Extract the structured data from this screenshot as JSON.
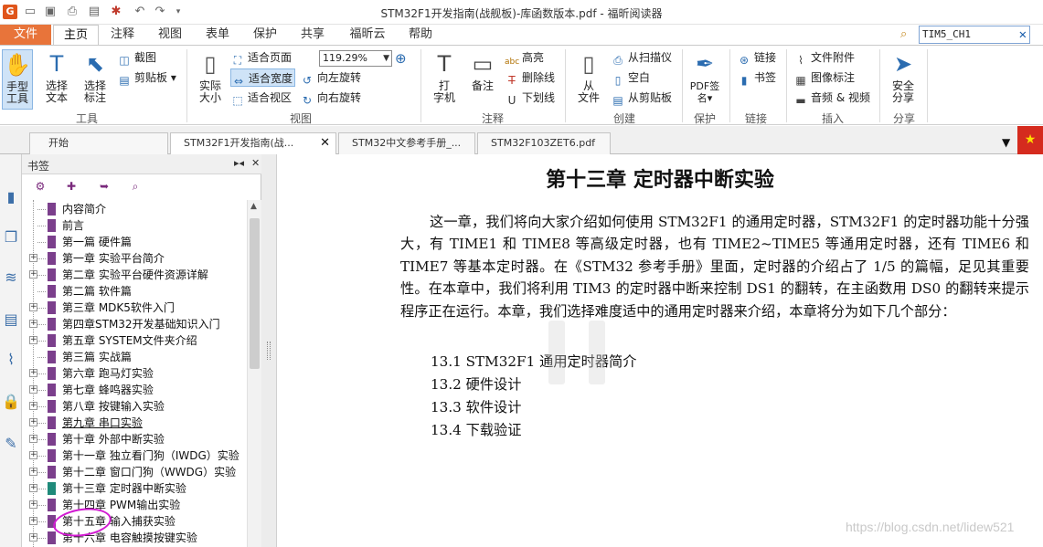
{
  "window": {
    "title": "STM32F1开发指南(战舰板)-库函数版本.pdf - 福昕阅读器"
  },
  "menu": {
    "file": "文件",
    "tabs": [
      "主页",
      "注释",
      "视图",
      "表单",
      "保护",
      "共享",
      "福昕云",
      "帮助"
    ],
    "active_tab": "主页",
    "search_value": "TIM5_CH1"
  },
  "ribbon": {
    "tools_group": {
      "label": "工具",
      "hand": "手型\n工具",
      "select_text": "选择\n文本",
      "select_annot": "选择\n标注",
      "snapshot": "截图",
      "clipboard": "剪贴板"
    },
    "view_group": {
      "label": "视图",
      "actual_size": "实际\n大小",
      "fit_page": "适合页面",
      "fit_width": "适合宽度",
      "fit_visible": "适合视区",
      "rotate_left": "向左旋转",
      "rotate_right": "向右旋转",
      "zoom": "119.29%"
    },
    "comment_group": {
      "label": "注释",
      "typewriter": "打\n字机",
      "note": "备注",
      "highlight": "高亮",
      "strikeout": "删除线",
      "underline": "下划线"
    },
    "create_group": {
      "label": "创建",
      "from_file": "从\n文件",
      "from_scanner": "从扫描仪",
      "blank": "空白",
      "from_clipboard": "从剪贴板"
    },
    "protect_group": {
      "label": "保护",
      "pdf_sign": "PDF签\n名"
    },
    "link_group": {
      "label": "链接",
      "link": "链接",
      "bookmark": "书签"
    },
    "insert_group": {
      "label": "插入",
      "file_attach": "文件附件",
      "image_annot": "图像标注",
      "audio_video": "音频 & 视频"
    },
    "share_group": {
      "label": "分享",
      "safe_share": "安全\n分享"
    }
  },
  "doc_tabs": [
    {
      "label": "开始"
    },
    {
      "label": "STM32F1开发指南(战..."
    },
    {
      "label": "STM32中文参考手册_..."
    },
    {
      "label": "STM32F103ZET6.pdf"
    }
  ],
  "bookmarks_panel": {
    "title": "书签",
    "items": [
      {
        "label": "内容简介",
        "expandable": false
      },
      {
        "label": "前言",
        "expandable": false
      },
      {
        "label": "第一篇 硬件篇",
        "expandable": false
      },
      {
        "label": "第一章 实验平台简介",
        "expandable": true
      },
      {
        "label": "第二章 实验平台硬件资源详解",
        "expandable": true
      },
      {
        "label": "第二篇 软件篇",
        "expandable": false
      },
      {
        "label": "第三章 MDK5软件入门",
        "expandable": true
      },
      {
        "label": "第四章STM32开发基础知识入门",
        "expandable": true
      },
      {
        "label": "第五章 SYSTEM文件夹介绍",
        "expandable": true
      },
      {
        "label": "第三篇 实战篇",
        "expandable": false
      },
      {
        "label": "第六章 跑马灯实验",
        "expandable": true
      },
      {
        "label": "第七章 蜂鸣器实验",
        "expandable": true
      },
      {
        "label": "第八章 按键输入实验",
        "expandable": true
      },
      {
        "label": "第九章 串口实验",
        "expandable": true
      },
      {
        "label": "第十章 外部中断实验",
        "expandable": true
      },
      {
        "label": "第十一章 独立看门狗（IWDG）实验",
        "expandable": true
      },
      {
        "label": "第十二章 窗口门狗（WWDG）实验",
        "expandable": true
      },
      {
        "label": "第十三章 定时器中断实验",
        "expandable": true
      },
      {
        "label": "第十四章 PWM输出实验",
        "expandable": true
      },
      {
        "label": "第十五章 输入捕获实验",
        "expandable": true
      },
      {
        "label": "第十六章 电容触摸按键实验",
        "expandable": true
      }
    ]
  },
  "document": {
    "chapter_title": "第十三章  定时器中断实验",
    "paragraph": "这一章，我们将向大家介绍如何使用 STM32F1 的通用定时器，STM32F1 的定时器功能十分强大，有 TIME1 和 TIME8 等高级定时器，也有 TIME2~TIME5 等通用定时器，还有 TIME6 和 TIME7 等基本定时器。在《STM32 参考手册》里面，定时器的介绍占了 1/5 的篇幅，足见其重要性。在本章中，我们将利用 TIM3 的定时器中断来控制 DS1 的翻转，在主函数用 DS0 的翻转来提示程序正在运行。本章，我们选择难度适中的通用定时器来介绍，本章将分为如下几个部分：",
    "toc": [
      "13.1 STM32F1 通用定时器简介",
      "13.2  硬件设计",
      "13.3  软件设计",
      "13.4 下载验证"
    ]
  },
  "watermark": "https://blog.csdn.net/lidew521"
}
